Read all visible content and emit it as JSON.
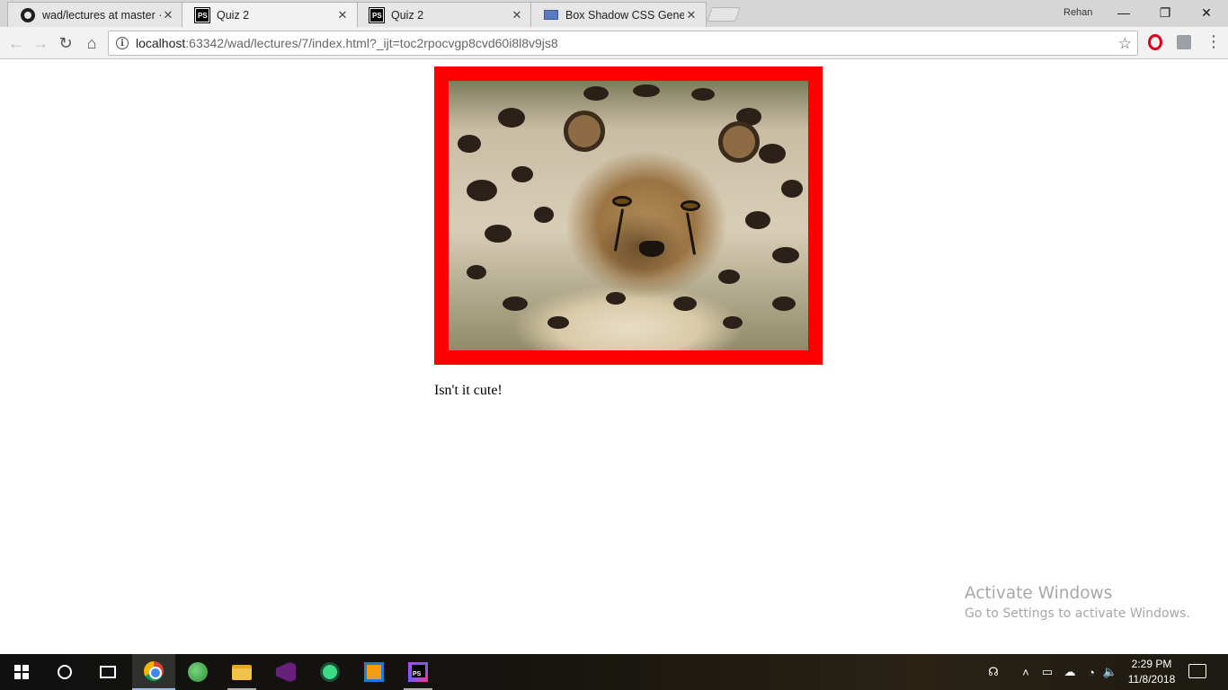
{
  "browser": {
    "tabs": [
      {
        "title": "wad/lectures at master · ",
        "favicon": "github-icon"
      },
      {
        "title": "Quiz 2",
        "favicon": "phpstorm-icon"
      },
      {
        "title": "Quiz 2",
        "favicon": "phpstorm-icon"
      },
      {
        "title": "Box Shadow CSS Generat",
        "favicon": "cssmatic-icon"
      }
    ],
    "active_tab_index": 1,
    "profile_name": "Rehan",
    "address": {
      "host": "localhost",
      "rest": ":63342/wad/lectures/7/index.html?_ijt=toc2rpocvgp8cvd60i8l8v9js8"
    }
  },
  "page": {
    "image_alt": "cheetah cub",
    "frame_color": "#ff0000",
    "caption": "Isn't it cute!"
  },
  "watermark": {
    "line1": "Activate Windows",
    "line2": "Go to Settings to activate Windows."
  },
  "taskbar": {
    "apps": [
      "windows-start",
      "cortana",
      "task-view",
      "chrome",
      "globe-app",
      "file-explorer",
      "visual-studio",
      "android-studio",
      "virtualbox",
      "phpstorm"
    ],
    "time": "2:29 PM",
    "date": "11/8/2018"
  }
}
